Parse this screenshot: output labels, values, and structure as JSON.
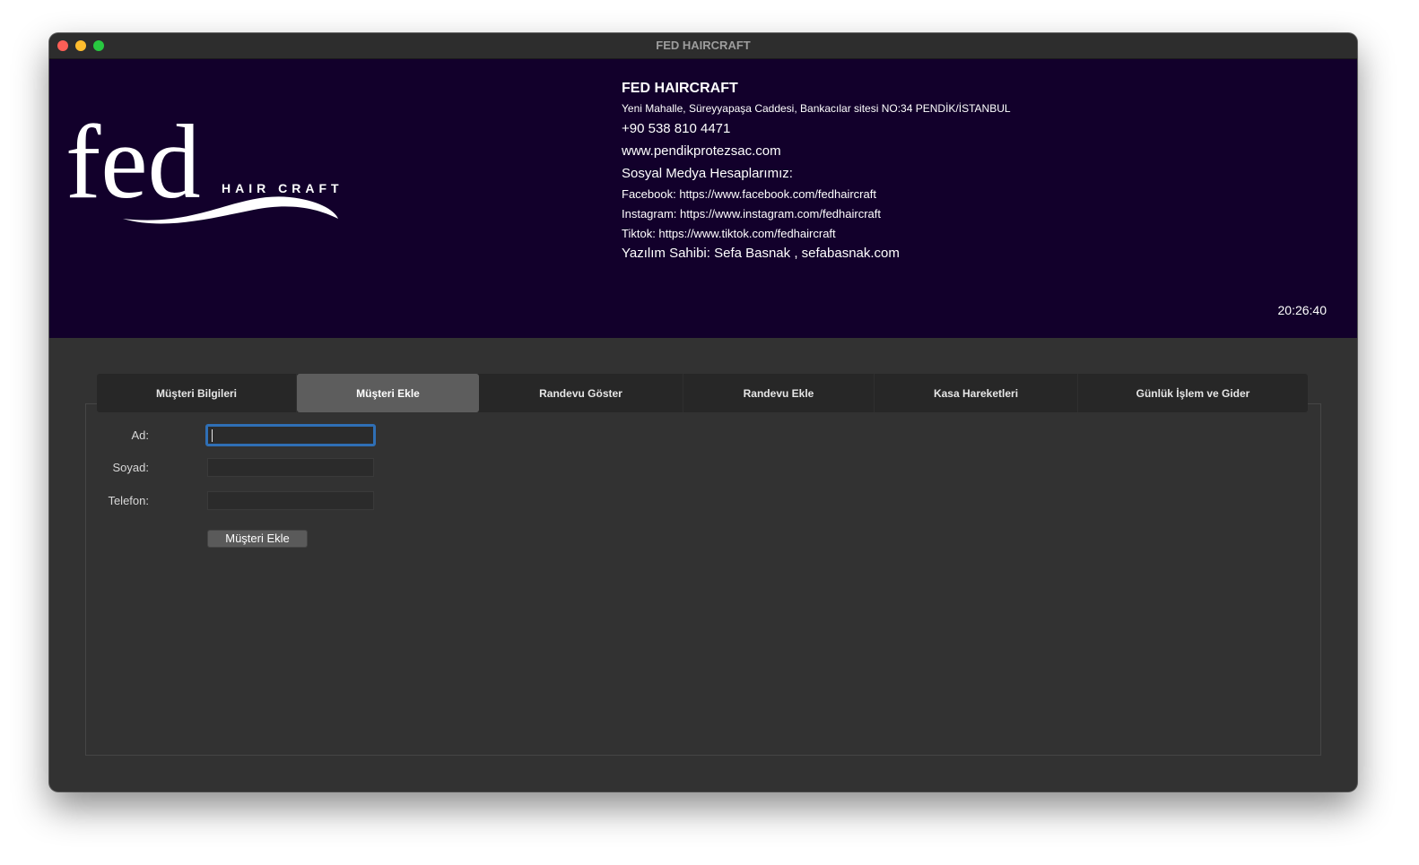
{
  "window": {
    "title": "FED HAIRCRAFT"
  },
  "header": {
    "logo_text": "fed",
    "logo_subtext": "HAIR CRAFT",
    "business_name": "FED HAIRCRAFT",
    "address": "Yeni Mahalle, Süreyyapaşa Caddesi, Bankacılar sitesi NO:34 PENDİK/İSTANBUL",
    "phone": "+90 538 810 4471",
    "website": "www.pendikprotezsac.com",
    "social_heading": "Sosyal Medya Hesaplarımız:",
    "facebook": "Facebook: https://www.facebook.com/fedhaircraft",
    "instagram": "Instagram: https://www.instagram.com/fedhaircraft",
    "tiktok": "Tiktok: https://www.tiktok.com/fedhaircraft",
    "author": "Yazılım Sahibi: Sefa Basnak , sefabasnak.com",
    "clock": "20:26:40",
    "background_color": "#12002b"
  },
  "tabs": [
    {
      "label": "Müşteri Bilgileri"
    },
    {
      "label": "Müşteri Ekle",
      "active": true
    },
    {
      "label": "Randevu Göster"
    },
    {
      "label": "Randevu Ekle"
    },
    {
      "label": "Kasa Hareketleri"
    },
    {
      "label": "Günlük İşlem ve Gider"
    }
  ],
  "form": {
    "first_name_label": "Ad:",
    "first_name_value": "",
    "last_name_label": "Soyad:",
    "last_name_value": "",
    "phone_label": "Telefon:",
    "phone_value": "",
    "submit_label": "Müşteri Ekle"
  }
}
